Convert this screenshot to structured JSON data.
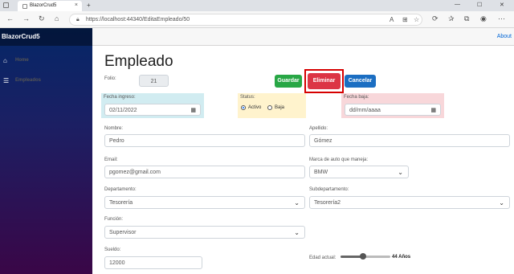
{
  "browser": {
    "tab_title": "BlazorCrud5",
    "url": "https://localhost:44340/EditaEmpleado/50"
  },
  "sidebar": {
    "brand": "BlazorCrud5",
    "items": [
      {
        "label": "Home",
        "icon": "home-icon"
      },
      {
        "label": "Empleados",
        "icon": "list-icon"
      }
    ]
  },
  "topbar": {
    "about": "About"
  },
  "page": {
    "title": "Empleado"
  },
  "form": {
    "folio_label": "Folio:",
    "folio_value": "21",
    "buttons": {
      "save": "Guardar",
      "delete": "Eliminar",
      "cancel": "Cancelar"
    },
    "fecha_ingreso": {
      "label": "Fecha ingreso:",
      "value": "02/11/2022"
    },
    "status": {
      "label": "Status:",
      "options": [
        "Activo",
        "Baja"
      ],
      "selected": "Activo"
    },
    "fecha_baja": {
      "label": "Fecha baja:",
      "placeholder": "dd/mm/aaaa"
    },
    "nombre": {
      "label": "Nombre:",
      "value": "Pedro"
    },
    "apellido": {
      "label": "Apellido:",
      "value": "Gómez"
    },
    "email": {
      "label": "Email:",
      "value": "pgomez@gmail.com"
    },
    "marca_auto": {
      "label": "Marca de auto que maneja:",
      "value": "BMW"
    },
    "departamento": {
      "label": "Departamento:",
      "value": "Tesorería"
    },
    "subdepartamento": {
      "label": "Subdepartamento:",
      "value": "Tesorería2"
    },
    "funcion": {
      "label": "Función:",
      "value": "Supervisor"
    },
    "sueldo": {
      "label": "Sueldo:",
      "value": "12000"
    },
    "edad": {
      "label": "Edad actual:",
      "value_text": "44 Años",
      "slider_fraction": 0.45
    }
  },
  "colors": {
    "success": "#28a745",
    "danger": "#dc3545",
    "primary": "#1b6ec2",
    "highlight_border": "#d60000"
  }
}
